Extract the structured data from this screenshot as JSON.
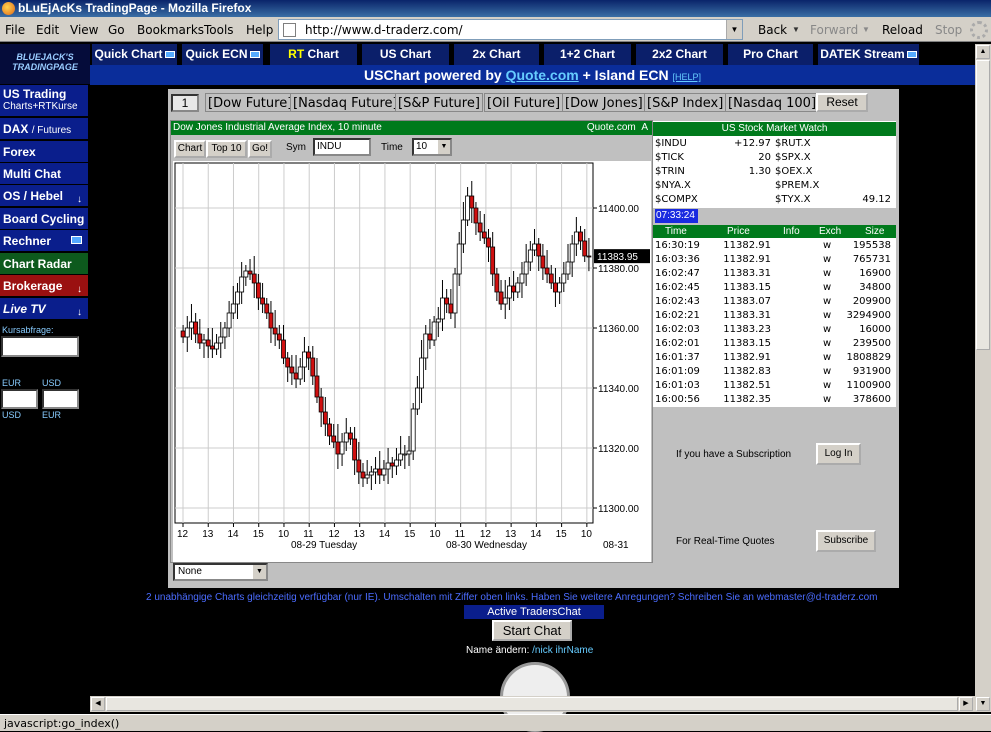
{
  "window": {
    "title": "bLuEjAcKs TradingPage - Mozilla Firefox"
  },
  "menu": [
    "File",
    "Edit",
    "View",
    "Go",
    "Bookmarks",
    "Tools",
    "Help"
  ],
  "url": "http://www.d-traderz.com/",
  "nav_buttons": {
    "back": "Back",
    "forward": "Forward",
    "reload": "Reload",
    "stop": "Stop"
  },
  "logo": {
    "line1": "BLUEJACK'S",
    "line2": "TRADINGPAGE"
  },
  "sidebar": {
    "us_trading": {
      "label": "US Trading",
      "sub": "Charts+RTKurse"
    },
    "dax": {
      "label": "DAX",
      "sub": "/ Futures"
    },
    "items": [
      "Forex",
      "Multi Chat",
      "OS / Hebel",
      "Board Cycling",
      "Rechner",
      "Chart Radar",
      "Brokerage",
      "Live TV"
    ],
    "kursabfrage": "Kursabfrage:",
    "cur_left_top": "EUR",
    "cur_right_top": "USD",
    "cur_left_bottom": "USD",
    "cur_right_bottom": "EUR"
  },
  "tabs": [
    {
      "label": "Quick Chart",
      "icon": true
    },
    {
      "label": "Quick ECN",
      "icon": true
    },
    {
      "prefix": "RT",
      "label": "Chart"
    },
    {
      "label": "US Chart"
    },
    {
      "label": "2x Chart"
    },
    {
      "label": "1+2 Chart"
    },
    {
      "label": "2x2 Chart"
    },
    {
      "label": "Pro Chart"
    },
    {
      "label": "DATEK Stream",
      "icon": true
    }
  ],
  "powered": {
    "pre": "USChart powered by",
    "link": "Quote.com",
    "post": "+ Island ECN",
    "help": "[HELP]"
  },
  "quick_select": "1",
  "quick_buttons": [
    "[Dow Future]",
    "[Nasdaq Future]",
    "[S&P Future]",
    "[Oil Future]",
    "[Dow Jones]",
    "[S&P Index]",
    "[Nasdaq 100]"
  ],
  "reset": "Reset",
  "chart": {
    "header": "Dow Jones Industrial Average Index, 10 minute",
    "source": "Quote.com",
    "header_tag": "A",
    "buttons": [
      "Chart",
      "Top 10",
      "Go!"
    ],
    "sym_label": "Sym",
    "sym_value": "INDU",
    "time_label": "Time",
    "time_value": "10",
    "overlay": "None"
  },
  "chart_data": {
    "type": "candlestick",
    "title": "Dow Jones Industrial Average Index, 10 minute",
    "ylim": [
      11295,
      11415
    ],
    "yticks": [
      11300.0,
      11320.0,
      11340.0,
      11360.0,
      11380.0,
      11400.0
    ],
    "ytick_labels": [
      "11300.00",
      "11320.00",
      "11340.00",
      "11360.00",
      "11380.00",
      "11400.00"
    ],
    "xticks": [
      "12",
      "13",
      "14",
      "15",
      "10",
      "11",
      "12",
      "13",
      "14",
      "15",
      "10",
      "11",
      "12",
      "13",
      "14",
      "15",
      "10"
    ],
    "xdates": [
      "08-29 Tuesday",
      "08-30 Wednesday",
      "08-31"
    ],
    "last_price": "11383.95",
    "close": [
      11357,
      11360,
      11362,
      11358,
      11355,
      11356,
      11354,
      11353,
      11355,
      11357,
      11360,
      11365,
      11368,
      11372,
      11377,
      11379,
      11378,
      11375,
      11370,
      11368,
      11365,
      11360,
      11358,
      11356,
      11350,
      11347,
      11345,
      11343,
      11347,
      11352,
      11350,
      11344,
      11337,
      11332,
      11328,
      11324,
      11322,
      11318,
      11322,
      11325,
      11323,
      11316,
      11312,
      11310,
      11311,
      11312,
      11313,
      11311,
      11313,
      11315,
      11314,
      11316,
      11318,
      11318,
      11319,
      11333,
      11340,
      11350,
      11358,
      11356,
      11362,
      11363,
      11370,
      11368,
      11365,
      11378,
      11388,
      11396,
      11404,
      11400,
      11395,
      11392,
      11390,
      11387,
      11378,
      11372,
      11368,
      11370,
      11374,
      11372,
      11375,
      11378,
      11382,
      11386,
      11388,
      11384,
      11380,
      11378,
      11375,
      11372,
      11375,
      11378,
      11382,
      11388,
      11392,
      11389,
      11384,
      11383.95
    ]
  },
  "market_watch": {
    "title": "US Stock Market Watch",
    "rows": [
      {
        "sym": "$INDU",
        "chg": "+12.97",
        "sym2": "$RUT.X",
        "val2": ""
      },
      {
        "sym": "$TICK",
        "chg": "20",
        "sym2": "$SPX.X",
        "val2": ""
      },
      {
        "sym": "$TRIN",
        "chg": "1.30",
        "sym2": "$OEX.X",
        "val2": ""
      },
      {
        "sym": "$NYA.X",
        "chg": "",
        "sym2": "$PREM.X",
        "val2": ""
      },
      {
        "sym": "$COMPX",
        "chg": "",
        "sym2": "$TYX.X",
        "val2": "49.12"
      }
    ]
  },
  "clock": "07:33:24",
  "trades": {
    "headers": [
      "Time",
      "Price",
      "Info",
      "Exch",
      "Size"
    ],
    "rows": [
      [
        "16:30:19",
        "11382.91",
        "",
        "w",
        "195538"
      ],
      [
        "16:03:36",
        "11382.91",
        "",
        "w",
        "765731"
      ],
      [
        "16:02:47",
        "11383.31",
        "",
        "w",
        "16900"
      ],
      [
        "16:02:45",
        "11383.15",
        "",
        "w",
        "34800"
      ],
      [
        "16:02:43",
        "11383.07",
        "",
        "w",
        "209900"
      ],
      [
        "16:02:21",
        "11383.31",
        "",
        "w",
        "3294900"
      ],
      [
        "16:02:03",
        "11383.23",
        "",
        "w",
        "16000"
      ],
      [
        "16:02:01",
        "11383.15",
        "",
        "w",
        "239500"
      ],
      [
        "16:01:37",
        "11382.91",
        "",
        "w",
        "1808829"
      ],
      [
        "16:01:09",
        "11382.83",
        "",
        "w",
        "931900"
      ],
      [
        "16:01:03",
        "11382.51",
        "",
        "w",
        "1100900"
      ],
      [
        "16:00:56",
        "11382.35",
        "",
        "w",
        "378600"
      ]
    ]
  },
  "subscription": {
    "text": "If you have a Subscription",
    "login": "Log In",
    "rt_text": "For Real-Time Quotes",
    "subscribe": "Subscribe"
  },
  "info_line": "2 unabhängige Charts gleichzeitig verfügbar (nur IE). Umschalten mit Ziffer oben links. Haben Sie weitere Anregungen? Schreiben Sie an webmaster@d-traderz.com",
  "chat": {
    "title": "Active TradersChat",
    "start": "Start Chat",
    "name_label": "Name ändern:",
    "name_value": "/nick ihrName"
  },
  "status_bar": "javascript:go_index()"
}
